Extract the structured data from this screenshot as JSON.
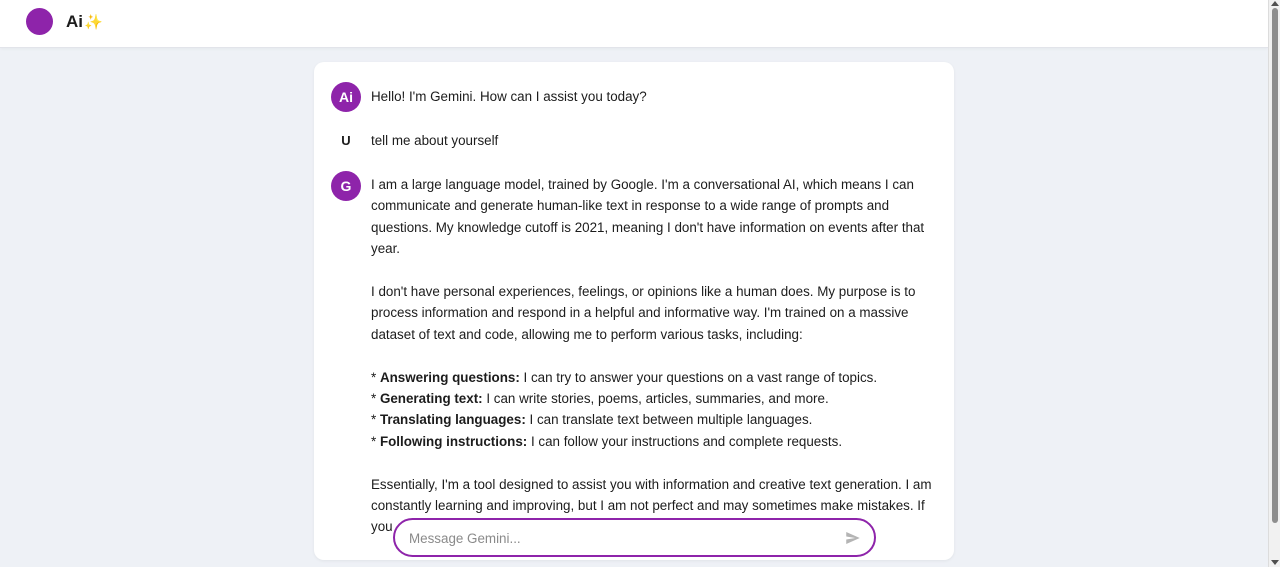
{
  "header": {
    "brand": "Ai",
    "brand_sparkle": "✨",
    "accent_color": "#8e24aa"
  },
  "messages": [
    {
      "avatar": "Ai",
      "role": "assistant",
      "text": "Hello! I'm Gemini. How can I assist you today?"
    },
    {
      "avatar": "U",
      "role": "user",
      "text": "tell me about yourself"
    },
    {
      "avatar": "G",
      "role": "assistant",
      "paragraphs": [
        "I am a large language model, trained by Google.  I'm a conversational AI, which means I can communicate and generate human-like text in response to a wide range of prompts and questions.  My knowledge cutoff is 2021, meaning I don't have information on events after that year.",
        "I don't have personal experiences, feelings, or opinions like a human does.  My purpose is to process information and respond in a helpful and informative way.  I'm trained on a massive dataset of text and code, allowing me to perform various tasks, including:"
      ],
      "bullets": [
        {
          "bullet": "* ",
          "title": "Answering questions:",
          "text": " I can try to answer your questions on a vast range of topics."
        },
        {
          "bullet": "* ",
          "title": "Generating text:",
          "text": " I can write stories, poems, articles, summaries, and more."
        },
        {
          "bullet": "* ",
          "title": "Translating languages:",
          "text": " I can translate text between multiple languages."
        },
        {
          "bullet": "* ",
          "title": "Following instructions:",
          "text": " I can follow your instructions and complete requests."
        }
      ],
      "closing": "Essentially, I'm a tool designed to assist you with information and creative text generation.  I am constantly learning and improving, but I am not perfect and may sometimes make mistakes.  If you"
    }
  ],
  "composer": {
    "placeholder": "Message Gemini...",
    "value": "",
    "send_icon": "send-icon"
  }
}
